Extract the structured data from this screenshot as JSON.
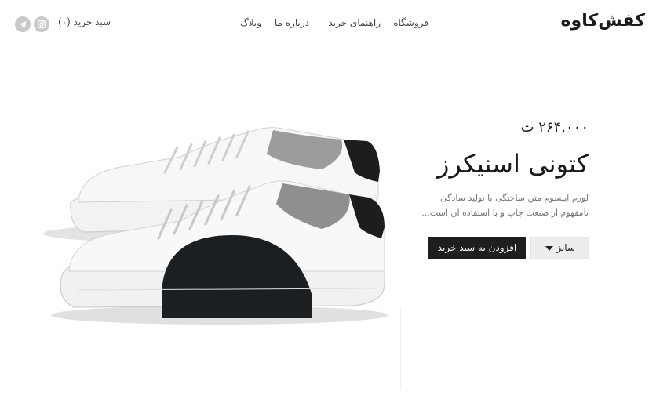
{
  "header": {
    "logo": "کفش‌کاوه",
    "nav": {
      "shop": "فروشگاه",
      "guide": "راهنمای خرید",
      "about": "درباره ما",
      "blog": "وبلاگ"
    },
    "cart": "سبد خرید (۰)",
    "social_icons": [
      "instagram-icon",
      "telegram-icon"
    ]
  },
  "product": {
    "price": "۲۶۴,۰۰۰ ت",
    "title": "کتونی اسنیکرز",
    "description_line1": "لورم ایپسوم متن ساختگی با تولید سادگی",
    "description_line2": "نامفهوم از صنعت چاپ و با استفاده آن است...",
    "size_label": "سایز",
    "add_to_cart": "افزودن به سبد خرید"
  },
  "colors": {
    "primary": "#1f1f1f",
    "muted_text": "#777777",
    "icon_gray": "#c9c9c9"
  }
}
